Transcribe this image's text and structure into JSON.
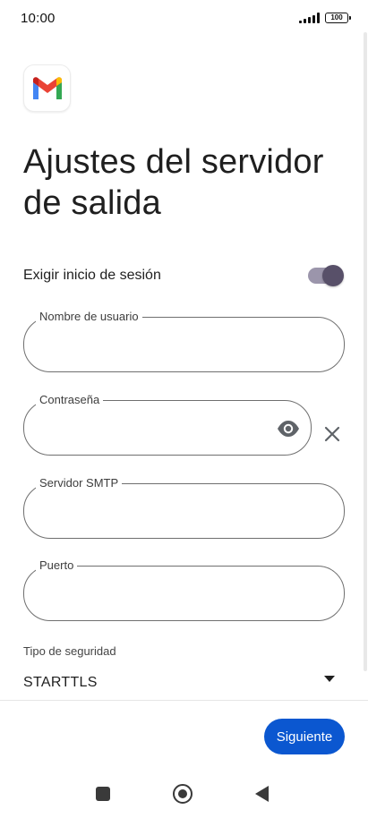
{
  "status_bar": {
    "time": "10:00",
    "battery": "100"
  },
  "logo": {
    "icon": "gmail-logo-icon"
  },
  "title": "Ajustes del servidor de salida",
  "require_signin": {
    "label": "Exigir inicio de sesión",
    "enabled": true
  },
  "fields": {
    "username": {
      "label": "Nombre de usuario",
      "value": ""
    },
    "password": {
      "label": "Contraseña",
      "value": ""
    },
    "smtp_server": {
      "label": "Servidor SMTP",
      "value": ""
    },
    "port": {
      "label": "Puerto",
      "value": ""
    }
  },
  "security": {
    "label": "Tipo de seguridad",
    "value": "STARTTLS"
  },
  "next_button": {
    "label": "Siguiente"
  },
  "colors": {
    "primary": "#0b57d0",
    "switch_track": "#9b95ab",
    "switch_knob": "#585069"
  },
  "nav_bar": {
    "recents_icon": "square-icon",
    "home_icon": "circle-icon",
    "back_icon": "triangle-back-icon"
  }
}
